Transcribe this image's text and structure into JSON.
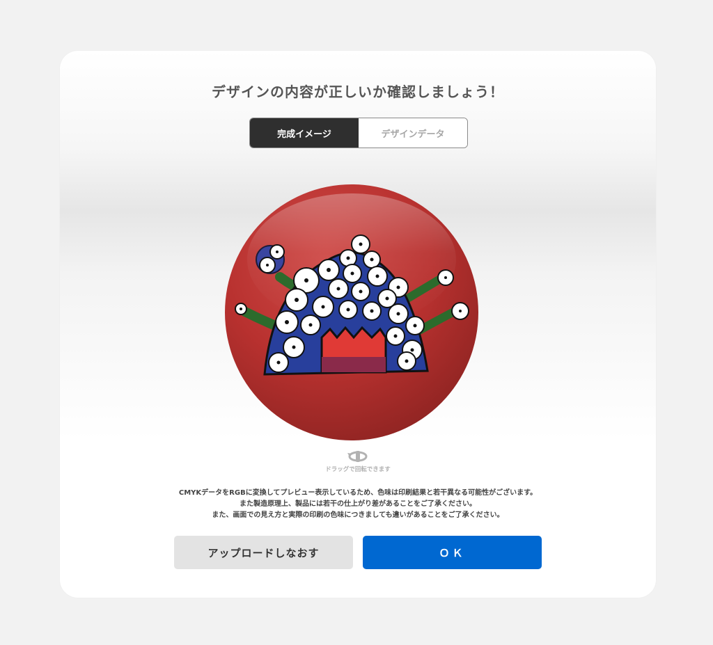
{
  "dialog": {
    "title": "デザインの内容が正しいか確認しましょう！"
  },
  "tabs": [
    {
      "label": "完成イメージ",
      "active": true
    },
    {
      "label": "デザインデータ",
      "active": false
    }
  ],
  "preview": {
    "product": "round-badge",
    "badge_color": "#b8312f",
    "rotate_hint": "ドラッグで回転できます"
  },
  "notice": {
    "lines": [
      "CMYKデータをRGBに変換してプレビュー表示しているため、色味は印刷結果と若干異なる可能性がございます。",
      "また製造原理上、製品には若干の仕上がり差があることをご了承ください。",
      "また、画面での見え方と実際の印刷の色味につきましても違いがあることをご了承ください。"
    ]
  },
  "buttons": {
    "reupload_label": "アップロードしなおす",
    "ok_label": "ＯＫ"
  },
  "colors": {
    "primary": "#0068d1",
    "tab_active": "#2f2f2f",
    "secondary_button": "#e3e3e3"
  }
}
